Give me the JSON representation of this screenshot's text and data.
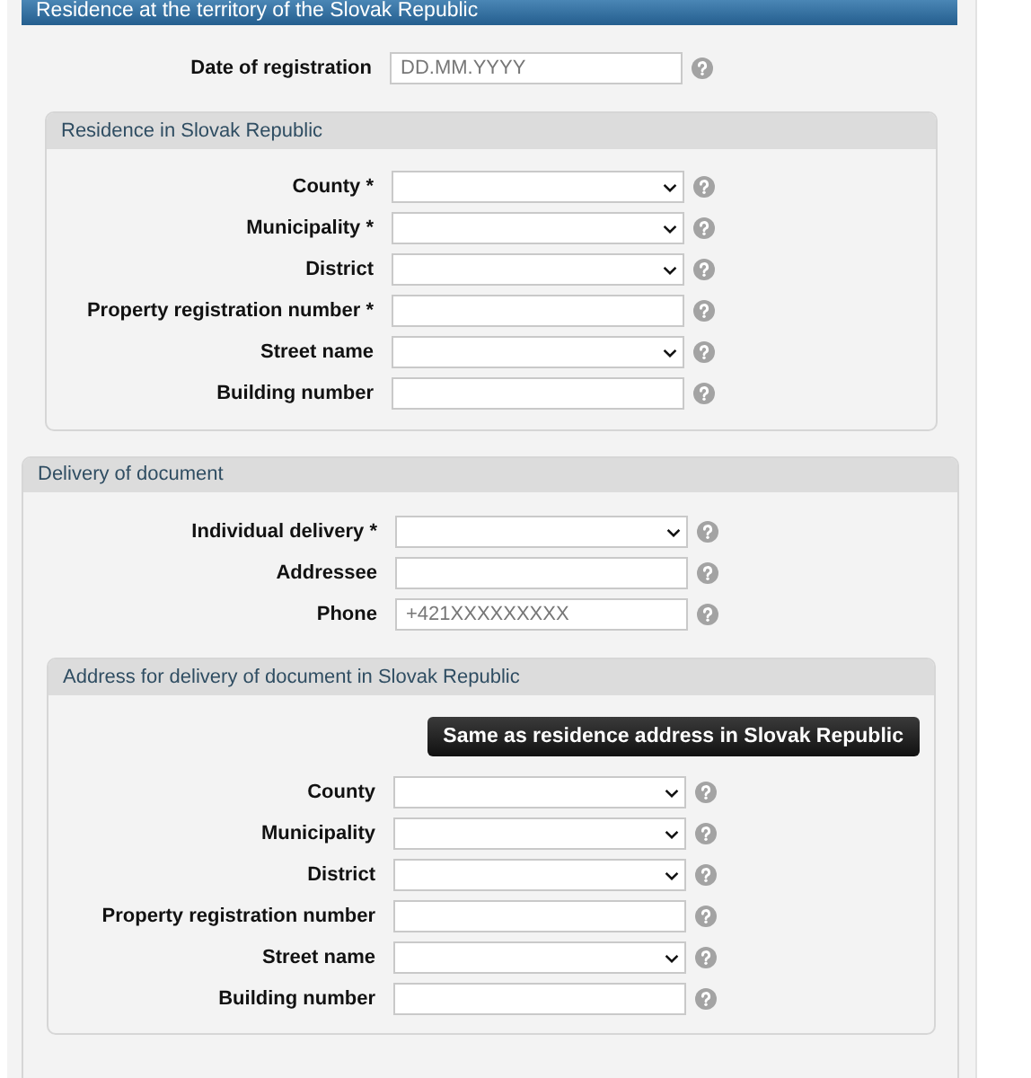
{
  "page_title": "Residence at the territory of the Slovak Republic",
  "fields": [
    {
      "label": "Date of registration",
      "kind": "text",
      "placeholder": "DD.MM.YYYY"
    }
  ],
  "residence": {
    "title": "Residence in Slovak Republic",
    "fields": [
      {
        "label": "County *",
        "kind": "select"
      },
      {
        "label": "Municipality *",
        "kind": "select"
      },
      {
        "label": "District",
        "kind": "select"
      },
      {
        "label": "Property registration number *",
        "kind": "text"
      },
      {
        "label": "Street name",
        "kind": "select"
      },
      {
        "label": "Building number",
        "kind": "text"
      }
    ]
  },
  "delivery": {
    "title": "Delivery of document",
    "fields": [
      {
        "label": "Individual delivery *",
        "kind": "select"
      },
      {
        "label": "Addressee",
        "kind": "text"
      },
      {
        "label": "Phone",
        "kind": "text",
        "placeholder": "+421XXXXXXXXX"
      }
    ],
    "address": {
      "title": "Address for delivery of document in Slovak Republic",
      "button": "Same as residence address in Slovak Republic",
      "fields": [
        {
          "label": "County",
          "kind": "select"
        },
        {
          "label": "Municipality",
          "kind": "select"
        },
        {
          "label": "District",
          "kind": "select"
        },
        {
          "label": "Property registration number",
          "kind": "text"
        },
        {
          "label": "Street name",
          "kind": "select"
        },
        {
          "label": "Building number",
          "kind": "text"
        }
      ]
    }
  }
}
